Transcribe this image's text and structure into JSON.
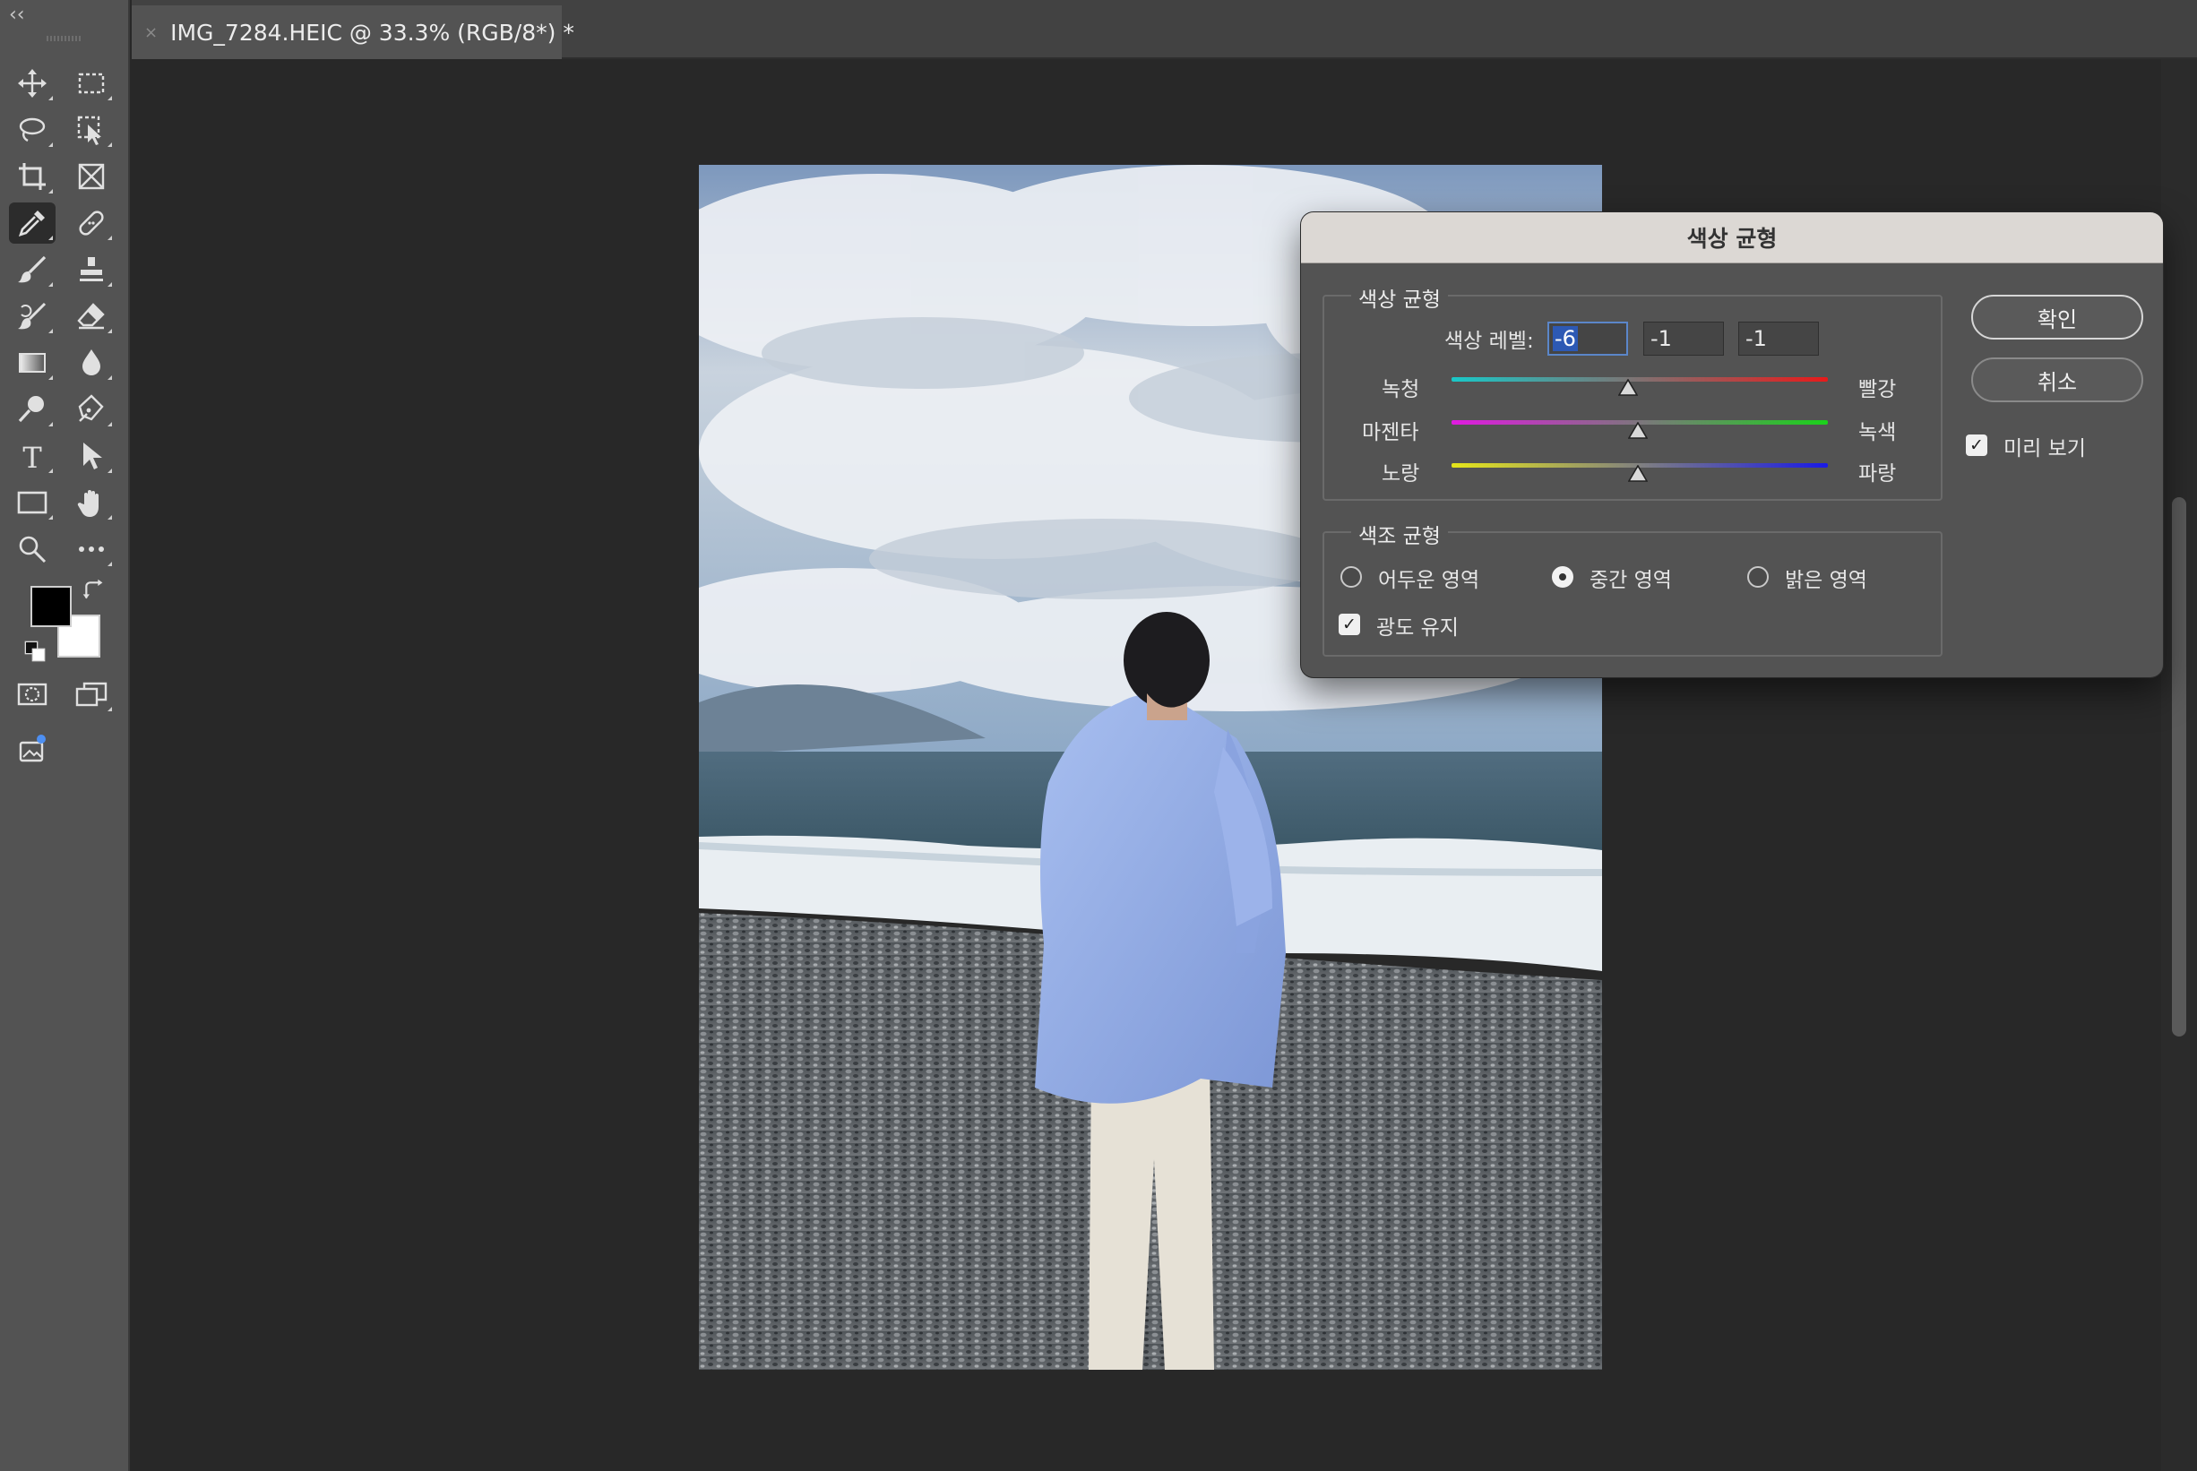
{
  "tab": {
    "title": "IMG_7284.HEIC @ 33.3% (RGB/8*) *",
    "close_symbol": "×"
  },
  "toolbar": {
    "collapse_symbol": "‹‹",
    "tools": [
      "move-tool",
      "rectangular-marquee-tool",
      "lasso-tool",
      "object-selection-tool",
      "crop-tool",
      "frame-tool",
      "eyedropper-tool",
      "spot-healing-brush-tool",
      "brush-tool",
      "clone-stamp-tool",
      "history-brush-tool",
      "eraser-tool",
      "gradient-tool",
      "blur-tool",
      "dodge-tool",
      "pen-tool",
      "type-tool",
      "path-selection-tool",
      "rectangle-tool",
      "hand-tool",
      "zoom-tool",
      "more-tools",
      "quick-mask-mode",
      "screen-mode",
      "generative-ai-tool"
    ],
    "active_tool": "eyedropper-tool",
    "foreground_color": "#000000",
    "background_color": "#ffffff",
    "type_tool_glyph": "T"
  },
  "dialog": {
    "title": "색상 균형",
    "color_balance_group": {
      "title": "색상 균형",
      "levels_label": "색상 레벨:",
      "levels": [
        "-6",
        "-1",
        "-1"
      ],
      "sliders": [
        {
          "left": "녹청",
          "right": "빨강",
          "value": -6,
          "min": -100,
          "max": 100
        },
        {
          "left": "마젠타",
          "right": "녹색",
          "value": -1,
          "min": -100,
          "max": 100
        },
        {
          "left": "노랑",
          "right": "파랑",
          "value": -1,
          "min": -100,
          "max": 100
        }
      ]
    },
    "tone_balance_group": {
      "title": "색조 균형",
      "options": [
        "어두운 영역",
        "중간 영역",
        "밝은 영역"
      ],
      "selected": "중간 영역",
      "preserve_luminosity_label": "광도 유지",
      "preserve_luminosity": true
    },
    "ok_label": "확인",
    "cancel_label": "취소",
    "preview_label": "미리 보기",
    "preview": true,
    "checkmark_glyph": "✓"
  },
  "colors": {
    "slider_gradients": [
      [
        "#19c8c8",
        "#e81a1a"
      ],
      [
        "#e01ae0",
        "#1ad21a"
      ],
      [
        "#e6e61a",
        "#1a1ae6"
      ]
    ],
    "selection_highlight": "#2d59b4"
  }
}
